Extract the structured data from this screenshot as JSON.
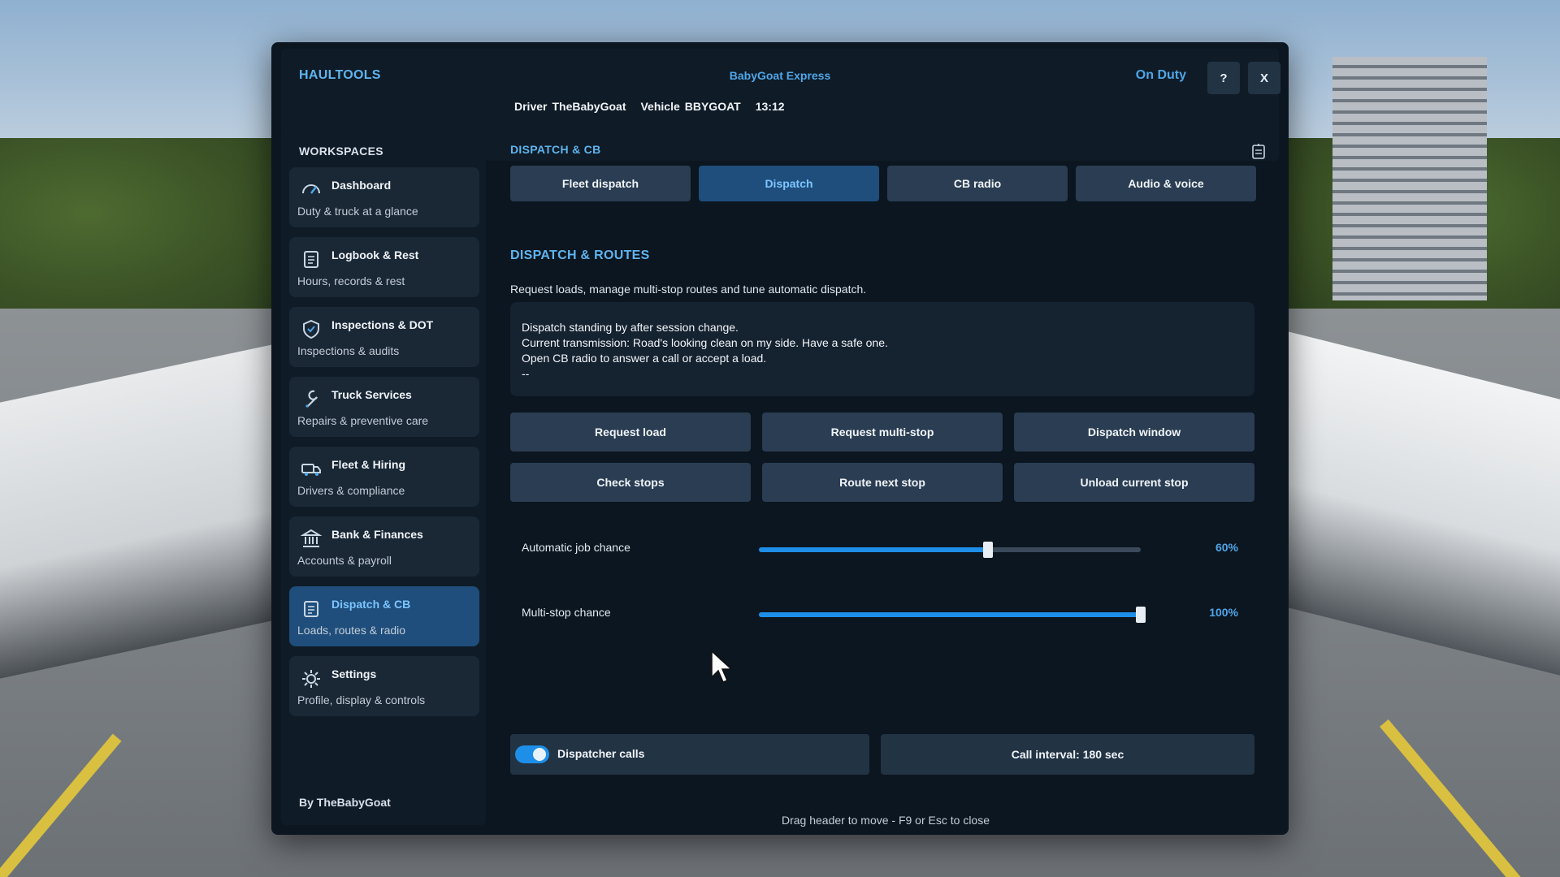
{
  "header": {
    "brand": "HAULTOOLS",
    "company": "BabyGoat Express",
    "duty_status": "On Duty",
    "help_label": "?",
    "close_label": "X",
    "driver_label": "Driver",
    "driver_name": "TheBabyGoat",
    "vehicle_label": "Vehicle",
    "vehicle_id": "BBYGOAT",
    "time": "13:12"
  },
  "sidebar": {
    "title": "WORKSPACES",
    "items": [
      {
        "label": "Dashboard",
        "sub": "Duty & truck at a glance",
        "icon": "gauge-icon"
      },
      {
        "label": "Logbook & Rest",
        "sub": "Hours, records & rest",
        "icon": "logbook-icon"
      },
      {
        "label": "Inspections & DOT",
        "sub": "Inspections & audits",
        "icon": "shield-check-icon"
      },
      {
        "label": "Truck Services",
        "sub": "Repairs & preventive care",
        "icon": "wrench-icon"
      },
      {
        "label": "Fleet & Hiring",
        "sub": "Drivers & compliance",
        "icon": "truck-icon"
      },
      {
        "label": "Bank & Finances",
        "sub": "Accounts & payroll",
        "icon": "bank-icon"
      },
      {
        "label": "Dispatch & CB",
        "sub": "Loads, routes & radio",
        "icon": "dispatch-icon"
      },
      {
        "label": "Settings",
        "sub": "Profile, display & controls",
        "icon": "gear-icon"
      }
    ],
    "active_index": 6,
    "footer": "By TheBabyGoat"
  },
  "main": {
    "section_title": "DISPATCH & CB",
    "tabs": [
      {
        "label": "Fleet dispatch"
      },
      {
        "label": "Dispatch"
      },
      {
        "label": "CB radio"
      },
      {
        "label": "Audio & voice"
      }
    ],
    "active_tab": 1,
    "sub_title": "DISPATCH & ROUTES",
    "description": "Request loads, manage multi-stop routes and tune automatic dispatch.",
    "log_lines": [
      "Dispatch standing by after session change.",
      "Current transmission: Road's looking clean on my side. Have a safe one.",
      "Open CB radio to answer a call or accept a load.",
      "--"
    ],
    "actions": [
      {
        "label": "Request load"
      },
      {
        "label": "Request multi-stop"
      },
      {
        "label": "Dispatch window"
      },
      {
        "label": "Check stops"
      },
      {
        "label": "Route next stop"
      },
      {
        "label": "Unload current stop"
      }
    ],
    "sliders": [
      {
        "label": "Automatic job chance",
        "value": 0.6,
        "value_text": "60%"
      },
      {
        "label": "Multi-stop chance",
        "value": 1.0,
        "value_text": "100%"
      }
    ],
    "dispatcher_calls": {
      "label": "Dispatcher calls",
      "enabled": true
    },
    "call_interval": "Call interval: 180 sec",
    "footer_hint": "Drag header to move - F9 or Esc to close"
  },
  "colors": {
    "accent": "#4fa6e8",
    "panel": "#0c1620",
    "button": "#2a3d52",
    "active": "#1f4e7c",
    "slider_fill": "#1e8fe8"
  }
}
